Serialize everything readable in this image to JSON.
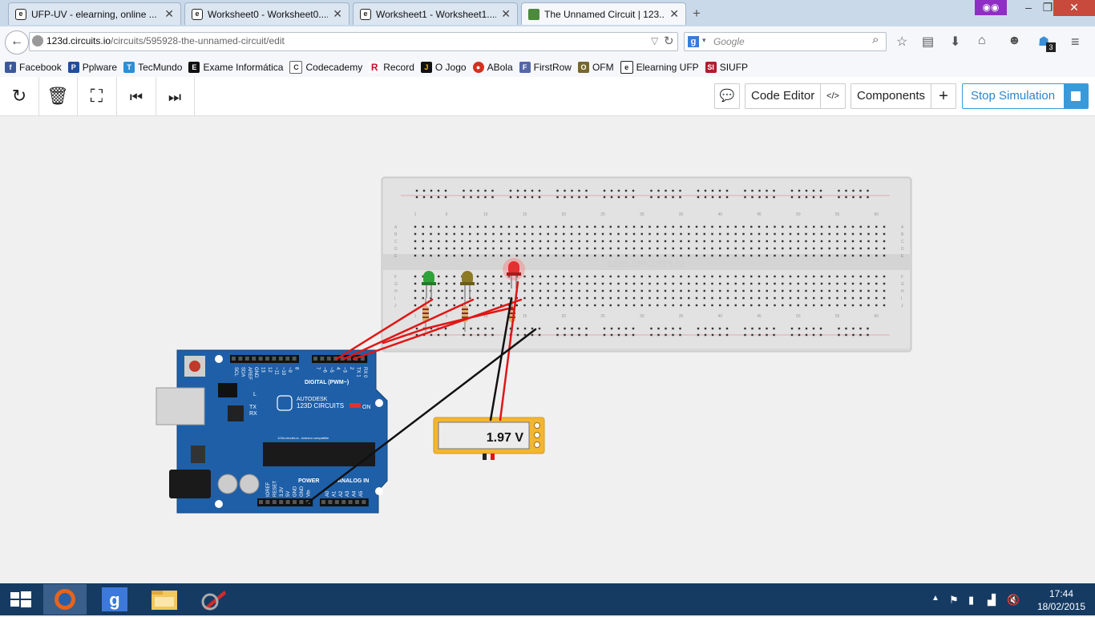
{
  "browser": {
    "tabs": [
      {
        "label": "UFP-UV - elearning, online ...",
        "icon": "page-icon"
      },
      {
        "label": "Worksheet0 - Worksheet0....",
        "icon": "page-icon"
      },
      {
        "label": "Worksheet1 - Worksheet1....",
        "icon": "page-icon"
      },
      {
        "label": "The Unnamed Circuit | 123...",
        "icon": "circuits-icon",
        "active": true
      }
    ],
    "new_tab": "+",
    "url_domain": "123d.circuits.io",
    "url_rest": "/circuits/595928-the-unnamed-circuit/edit",
    "url_prefix": "",
    "search_placeholder": "Google",
    "notification_count": "3",
    "bookmarks": [
      {
        "label": "Facebook",
        "color": "#3b5998"
      },
      {
        "label": "Pplware",
        "color": "#1f4e9b"
      },
      {
        "label": "TecMundo",
        "color": "#2d8fd5"
      },
      {
        "label": "Exame Informática",
        "color": "#111111"
      },
      {
        "label": "Codecademy",
        "color": "#666666"
      },
      {
        "label": "Record",
        "color": "#c8102e"
      },
      {
        "label": "O Jogo",
        "color": "#111111"
      },
      {
        "label": "ABola",
        "color": "#d3311e"
      },
      {
        "label": "FirstRow",
        "color": "#5566aa"
      },
      {
        "label": "OFM",
        "color": "#776633"
      },
      {
        "label": "Elearning UFP",
        "color": "#222222"
      },
      {
        "label": "SIUFP",
        "color": "#b01c2e"
      }
    ]
  },
  "toolbar": {
    "code_editor_label": "Code Editor",
    "components_label": "Components",
    "stop_simulation_label": "Stop Simulation"
  },
  "circuit": {
    "breadboard_watermark": "123D.CIRCUITS.IO",
    "column_numbers": [
      "1",
      "5",
      "10",
      "15",
      "20",
      "25",
      "30",
      "35",
      "40",
      "45",
      "50",
      "55",
      "60"
    ],
    "row_letters_top": [
      "A",
      "B",
      "C",
      "D",
      "E"
    ],
    "row_letters_bottom": [
      "F",
      "G",
      "H",
      "I",
      "J"
    ],
    "multimeter_reading": "1.97 V",
    "arduino": {
      "brand": "AUTODESK",
      "model": "123D CIRCUITS",
      "digital_label": "DIGITAL (PWM~)",
      "power_label": "POWER",
      "analog_label": "ANALOG IN",
      "on_label": "ON",
      "tx_label": "TX",
      "rx_label": "RX",
      "l_label": "L",
      "url_label": "123d.circuits.io - Arduino compatible",
      "digital_pins": [
        "SCL",
        "SDA",
        "AREF",
        "GND",
        "13",
        "12",
        "~11",
        "~10",
        "~9",
        "8",
        "7",
        "~6",
        "~5",
        "4",
        "~3",
        "2",
        "TX 1",
        "RX 0"
      ],
      "power_pins": [
        "IOREF",
        "RESET",
        "3.3V",
        "5V",
        "GND",
        "GND",
        "Vin"
      ],
      "analog_pins": [
        "A0",
        "A1",
        "A2",
        "A3",
        "A4",
        "A5"
      ]
    },
    "led_colors": {
      "green": "#2fa33a",
      "yellow": "#8c7a25",
      "red": "#e33030"
    },
    "wire_colors": {
      "red": "#e01616",
      "black": "#111111"
    }
  },
  "taskbar": {
    "time": "17:44",
    "date": "18/02/2015",
    "apps": [
      "start-button",
      "firefox-icon",
      "google-icon",
      "file-explorer-icon",
      "ccleaner-icon"
    ]
  },
  "colors": {
    "accent": "#3a9ad9",
    "taskbar": "#163b63",
    "tabbar": "#c9d9ea"
  }
}
